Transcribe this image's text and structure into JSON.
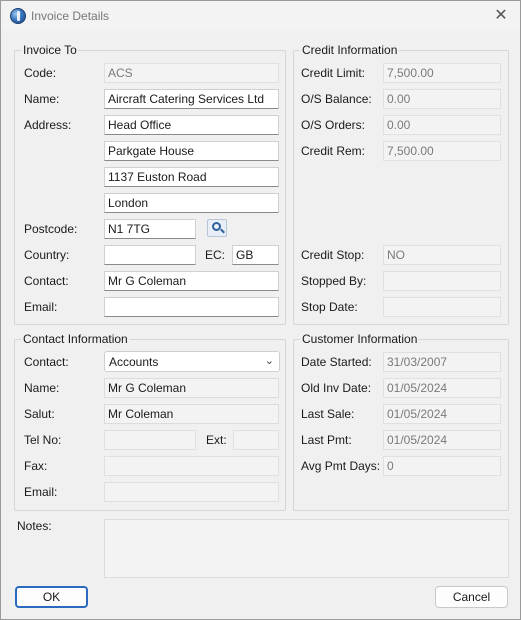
{
  "window": {
    "title": "Invoice Details",
    "close_glyph": "✕"
  },
  "invoice_to": {
    "legend": "Invoice To",
    "code_label": "Code:",
    "code_value": "ACS",
    "name_label": "Name:",
    "name_value": "Aircraft Catering Services Ltd",
    "address_label": "Address:",
    "address_lines": [
      "Head Office",
      "Parkgate House",
      "1137 Euston Road",
      "London"
    ],
    "postcode_label": "Postcode:",
    "postcode_value": "N1 7TG",
    "country_label": "Country:",
    "country_value": "",
    "ec_label": "EC:",
    "ec_value": "GB",
    "contact_label": "Contact:",
    "contact_value": "Mr G Coleman",
    "email_label": "Email:",
    "email_value": ""
  },
  "credit_info": {
    "legend": "Credit Information",
    "limit_label": "Credit Limit:",
    "limit_value": "7,500.00",
    "os_balance_label": "O/S Balance:",
    "os_balance_value": "0.00",
    "os_orders_label": "O/S Orders:",
    "os_orders_value": "0.00",
    "rem_label": "Credit Rem:",
    "rem_value": "7,500.00",
    "stop_label": "Credit Stop:",
    "stop_value": "NO",
    "stopped_by_label": "Stopped By:",
    "stopped_by_value": "",
    "stop_date_label": "Stop Date:",
    "stop_date_value": ""
  },
  "contact_info": {
    "legend": "Contact Information",
    "contact_label": "Contact:",
    "contact_selected": "Accounts",
    "name_label": "Name:",
    "name_value": "Mr G Coleman",
    "salut_label": "Salut:",
    "salut_value": "Mr Coleman",
    "tel_label": "Tel No:",
    "tel_value": "",
    "ext_label": "Ext:",
    "ext_value": "",
    "fax_label": "Fax:",
    "fax_value": "",
    "email_label": "Email:",
    "email_value": ""
  },
  "customer_info": {
    "legend": "Customer Information",
    "date_started_label": "Date Started:",
    "date_started_value": "31/03/2007",
    "old_inv_label": "Old Inv Date:",
    "old_inv_value": "01/05/2024",
    "last_sale_label": "Last Sale:",
    "last_sale_value": "01/05/2024",
    "last_pmt_label": "Last Pmt:",
    "last_pmt_value": "01/05/2024",
    "avg_pmt_label": "Avg Pmt Days:",
    "avg_pmt_value": "0"
  },
  "notes": {
    "label": "Notes:",
    "value": ""
  },
  "buttons": {
    "ok": "OK",
    "cancel": "Cancel"
  },
  "icons": {
    "app": "app-icon",
    "search": "search-icon",
    "dropdown": "chevron-down-icon",
    "close": "close-icon"
  }
}
